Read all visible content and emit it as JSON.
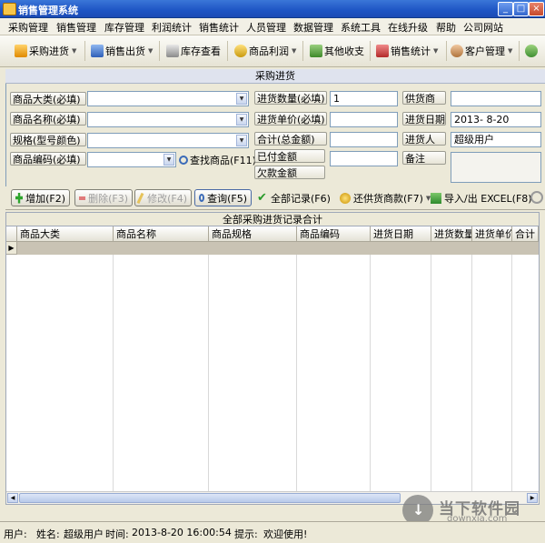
{
  "window": {
    "title": "销售管理系统",
    "minimize": "_",
    "maximize": "□",
    "close": "×"
  },
  "menu": [
    "采购管理",
    "销售管理",
    "库存管理",
    "利润统计",
    "销售统计",
    "人员管理",
    "数据管理",
    "系统工具",
    "在线升级",
    "帮助",
    "公司网站"
  ],
  "toolbar": {
    "items": [
      {
        "label": "采购进货",
        "icon": "purchase-icon"
      },
      {
        "label": "销售出货",
        "icon": "sales-icon"
      },
      {
        "label": "库存查看",
        "icon": "inventory-icon"
      },
      {
        "label": "商品利润",
        "icon": "profit-icon"
      },
      {
        "label": "其他收支",
        "icon": "income-expense-icon"
      },
      {
        "label": "销售统计",
        "icon": "sales-stats-icon"
      },
      {
        "label": "客户管理",
        "icon": "customer-icon"
      }
    ]
  },
  "form": {
    "panel_title": "采购进货",
    "category_label": "商品大类(必填)",
    "category_value": "",
    "name_label": "商品名称(必填)",
    "name_value": "",
    "spec_label": "规格(型号颜色)",
    "spec_value": "",
    "code_label": "商品编码(必填)",
    "code_value": "",
    "find_goods_label": "查找商品(F11)",
    "qty_label": "进货数量(必填)",
    "qty_value": "1",
    "price_label": "进货单价(必填)",
    "price_value": "",
    "total_label": "合计(总金额)",
    "total_value": "",
    "paid_label": "已付金额",
    "paid_value": "",
    "owed_label": "欠款金额",
    "supplier_label": "供货商",
    "supplier_value": "",
    "date_label": "进货日期",
    "date_value": "2013- 8-20",
    "buyer_label": "进货人",
    "buyer_value": "超级用户",
    "note_label": "备注",
    "note_value": ""
  },
  "actions": {
    "add": "增加(F2)",
    "delete": "删除(F3)",
    "edit": "修改(F4)",
    "query": "查询(F5)",
    "all_records": "全部记录(F6)",
    "repay": "还供货商款(F7)",
    "import_export": "导入/出 EXCEL(F8)"
  },
  "grid": {
    "caption": "全部采购进货记录合计",
    "columns": [
      "商品大类",
      "商品名称",
      "商品规格",
      "商品编码",
      "进货日期",
      "进货数量",
      "进货单价",
      "合计"
    ],
    "rows": []
  },
  "status": {
    "user_label": "用户:",
    "name_label": "姓名:",
    "user_name": "超级用户",
    "time_label": "时间:",
    "time_value": "2013-8-20 16:00:54",
    "tip_label": "提示:",
    "tip_value": "欢迎使用!"
  },
  "watermark": {
    "text": "当下软件园",
    "url": "downxia.com"
  },
  "colors": {
    "titlebar": "#1e55c4",
    "panel": "#ece9d8",
    "selected_row": "#c9c3b4"
  }
}
